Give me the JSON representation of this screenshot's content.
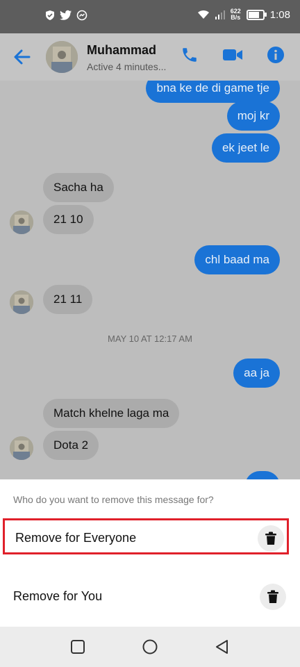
{
  "status_bar": {
    "net_speed_value": "622",
    "net_speed_unit": "B/s",
    "time": "1:08"
  },
  "header": {
    "contact_name": "Muhammad",
    "status": "Active 4 minutes..."
  },
  "messages": [
    {
      "text": "bna ke de di game tje",
      "dir": "out"
    },
    {
      "text": "moj kr",
      "dir": "out"
    },
    {
      "text": "ek jeet le",
      "dir": "out"
    },
    {
      "text": "Sacha ha",
      "dir": "in"
    },
    {
      "text": "21 10",
      "dir": "in"
    },
    {
      "text": "chl baad ma",
      "dir": "out"
    },
    {
      "text": "21 11",
      "dir": "in"
    },
    {
      "text": "aa ja",
      "dir": "out"
    },
    {
      "text": "Match khelne laga ma",
      "dir": "in"
    },
    {
      "text": "Dota 2",
      "dir": "in"
    }
  ],
  "date_separator": "MAY 10 AT 12:17 AM",
  "sheet": {
    "question": "Who do you want to remove this message for?",
    "option_everyone": "Remove for Everyone",
    "option_you": "Remove for You"
  },
  "colors": {
    "messenger_blue": "#1a73d6",
    "highlight_red": "#e0202a"
  },
  "icons": [
    "shield-icon",
    "twitter-icon",
    "messenger-icon",
    "wifi-icon",
    "signal-icon",
    "battery-icon",
    "back-arrow-icon",
    "phone-icon",
    "video-icon",
    "info-icon",
    "trash-icon",
    "square-nav-icon",
    "circle-nav-icon",
    "triangle-nav-icon"
  ]
}
